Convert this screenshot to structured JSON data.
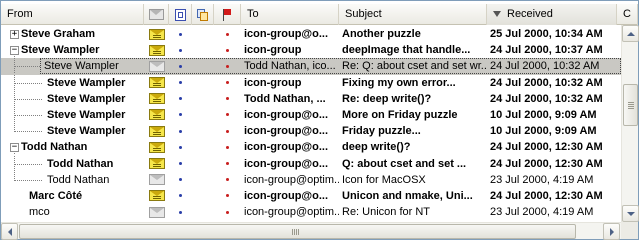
{
  "columns": {
    "from": "From",
    "to": "To",
    "subject": "Subject",
    "received": "Received",
    "extra": "C",
    "icons": [
      "envelope-icon",
      "attachment-icon",
      "priority-icon",
      "flag-icon"
    ]
  },
  "rows": [
    {
      "from": "Steve Graham",
      "to": "icon-group@o...",
      "subject": "Another puzzle",
      "received": "25 Jul 2000, 10:34 AM",
      "bold": true,
      "level": 0,
      "expander": "+",
      "unread": true,
      "selected": false
    },
    {
      "from": "Steve Wampler",
      "to": "icon-group",
      "subject": "deepImage that handle...",
      "received": "24 Jul 2000, 10:37 AM",
      "bold": true,
      "level": 0,
      "expander": "−",
      "unread": true,
      "selected": false
    },
    {
      "from": "Steve Wampler",
      "to": "Todd Nathan, ico...",
      "subject": "Re: Q: about cset and set wr...",
      "received": "24 Jul 2000, 10:32 AM",
      "bold": false,
      "level": 1,
      "expander": "",
      "unread": false,
      "selected": true
    },
    {
      "from": "Steve Wampler",
      "to": "icon-group",
      "subject": "Fixing my own error...",
      "received": "24 Jul 2000, 10:32 AM",
      "bold": true,
      "level": 1,
      "expander": "",
      "unread": true,
      "selected": false
    },
    {
      "from": "Steve Wampler",
      "to": "Todd Nathan, ...",
      "subject": "Re: deep write()?",
      "received": "24 Jul 2000, 10:32 AM",
      "bold": true,
      "level": 1,
      "expander": "",
      "unread": true,
      "selected": false
    },
    {
      "from": "Steve Wampler",
      "to": "icon-group@o...",
      "subject": "More on Friday puzzle",
      "received": "10 Jul 2000, 9:09 AM",
      "bold": true,
      "level": 1,
      "expander": "",
      "unread": true,
      "selected": false
    },
    {
      "from": "Steve Wampler",
      "to": "icon-group@o...",
      "subject": "Friday puzzle...",
      "received": "10 Jul 2000, 9:09 AM",
      "bold": true,
      "level": 1,
      "expander": "",
      "unread": true,
      "selected": false
    },
    {
      "from": "Todd Nathan",
      "to": "icon-group@o...",
      "subject": "deep write()?",
      "received": "24 Jul 2000, 12:30 AM",
      "bold": true,
      "level": 0,
      "expander": "−",
      "unread": true,
      "selected": false
    },
    {
      "from": "Todd Nathan",
      "to": "icon-group@o...",
      "subject": "Q: about cset and set ...",
      "received": "24 Jul 2000, 12:30 AM",
      "bold": true,
      "level": 1,
      "expander": "",
      "unread": true,
      "selected": false
    },
    {
      "from": "Todd Nathan",
      "to": "icon-group@optim...",
      "subject": "Icon for MacOSX",
      "received": "23 Jul 2000, 4:19 AM",
      "bold": false,
      "level": 1,
      "expander": "",
      "unread": false,
      "selected": false
    },
    {
      "from": "Marc Côté",
      "to": "icon-group@o...",
      "subject": "Unicon and nmake, Uni...",
      "received": "24 Jul 2000, 12:30 AM",
      "bold": true,
      "level": 0,
      "expander": "",
      "unread": true,
      "selected": false
    },
    {
      "from": "mco",
      "to": "icon-group@optim...",
      "subject": "Re: Unicon for NT",
      "received": "23 Jul 2000, 4:19 AM",
      "bold": false,
      "level": 0,
      "expander": "",
      "unread": false,
      "selected": false
    }
  ],
  "colors": {
    "selected_row": "#c9c8c3",
    "unread_envelope": "#f6e64a",
    "priority_dot": "#2a3ea8",
    "flag_dot": "#c81e1e"
  }
}
